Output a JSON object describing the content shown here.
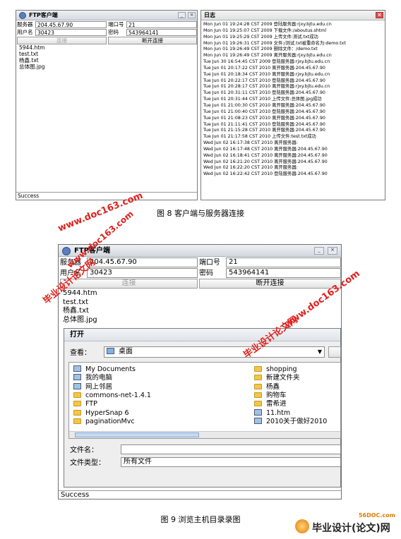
{
  "screenshot1": {
    "client_title": "FTP客户端",
    "server_label": "服务器",
    "server_value": "204.45.67.90",
    "port_label": "端口号",
    "port_value": "21",
    "user_label": "用户名",
    "user_value": "30423",
    "password_label": "密码",
    "password_value": "543964141",
    "connect_button": "连接",
    "disconnect_button": "断开连接",
    "files": [
      "5944.htm",
      "test.txt",
      "杨鑫.txt",
      "总体图.jpg"
    ],
    "status": "Success",
    "log_title": "日志",
    "log_lines": [
      "Mon Jun 01 19:24:28 CST 2009 登陆服务器:rjxy.bjtu.edu.cn",
      "Mon Jun 01 19:25:07 CST 2009 下载文件:/aboutus.shtml",
      "Mon Jun 01 19:25:29 CST 2009 上传文件:测试.txt成功",
      "Mon Jun 01 19:26:31 CST 2009 文件:/测试.txt被重命名为:demo.txt",
      "Mon Jun 01 19:26:49 CST 2009 删除文件：/demo.txt",
      "Mon Jun 01 19:26:49 CST 2009 离开服务器:rjxy.bjtu.edu.cn",
      "Tue Jun 30 16:54:45 CST 2009 登陆服务器:rjxy.bjtu.edu.cn",
      "Tue Jun 01 20:17:22 CST 2010 离开服务器:204.45.67.90",
      "Tue Jun 01 20:18:34 CST 2010 离开服务器:rjxy.bjtu.edu.cn",
      "Tue Jun 01 20:22:17 CST 2010 登陆服务器:204.45.67.90",
      "Tue Jun 01 20:28:17 CST 2010 离开服务器:rjxy.bjtu.edu.cn",
      "Tue Jun 01 20:31:11 CST 2010 登陆服务器:204.45.67.90",
      "Tue Jun 01 20:31:44 CST 2010 上传文件:总体图.jpg成功",
      "Tue Jun 01 21:00:30 CST 2010 离开服务器:204.45.67.90",
      "Tue Jun 01 21:00:40 CST 2010 登陆服务器:204.45.67.90",
      "Tue Jun 01 21:08:23 CST 2010 离开服务器:204.45.67.90",
      "Tue Jun 01 21:11:41 CST 2010 登陆服务器:204.45.67.90",
      "Tue Jun 01 21:15:28 CST 2010 离开服务器:204.45.67.90",
      "Tue Jun 01 21:17:58 CST 2010 上传文件:test.txt成功",
      "Wed Jun 02 16:17:38 CST 2010 离开服务器:",
      "Wed Jun 02 16:17:48 CST 2010 离开服务器:204.45.67.90",
      "Wed Jun 02 16:18:41 CST 2010 离开服务器:204.45.67.90",
      "Wed Jun 02 16:21:20 CST 2010 离开服务器:204.45.67.90",
      "Wed Jun 02 16:22:20 CST 2010 离开服务器:",
      "Wed Jun 02 16:22:42 CST 2010 登陆服务器:204.45.67.90"
    ]
  },
  "caption1": "图 8  客户端与服务器连接",
  "screenshot2": {
    "client_title": "FTP客户端",
    "server_label": "服务器",
    "server_value": "204.45.67.90",
    "port_label": "端口号",
    "port_value": "21",
    "user_label": "用户名",
    "user_value": "30423",
    "password_label": "密码",
    "password_value": "543964141",
    "connect_button": "连接",
    "disconnect_button": "断开连接",
    "files": [
      "5944.htm",
      "test.txt",
      "杨鑫.txt",
      "总体图.jpg"
    ],
    "status": "Success",
    "dialog": {
      "title": "打开",
      "look_in_label": "查看：",
      "look_in_value": "桌面",
      "left_items": [
        "My Documents",
        "我的电脑",
        "网上邻居",
        "commons-net-1.4.1",
        "FTP",
        "HyperSnap 6",
        "paginationMvc"
      ],
      "right_items": [
        "shopping",
        "新建文件夹",
        "杨鑫",
        "购物车",
        "雷希进",
        "11.htm",
        "2010关于做好2010"
      ],
      "filename_label": "文件名：",
      "filetype_label": "文件类型：",
      "filetype_value": "所有文件"
    }
  },
  "caption2": "图 9  浏览主机目录录图",
  "watermarks": {
    "url": "www.doc163.com",
    "site": "毕业设计论文网",
    "brand_url": "56DOC.com",
    "brand_text": "毕业设计(论文)网"
  },
  "colors": {
    "watermark": "#e0201c",
    "folder": "#f3c64a",
    "selection": "#c5d9f1"
  }
}
